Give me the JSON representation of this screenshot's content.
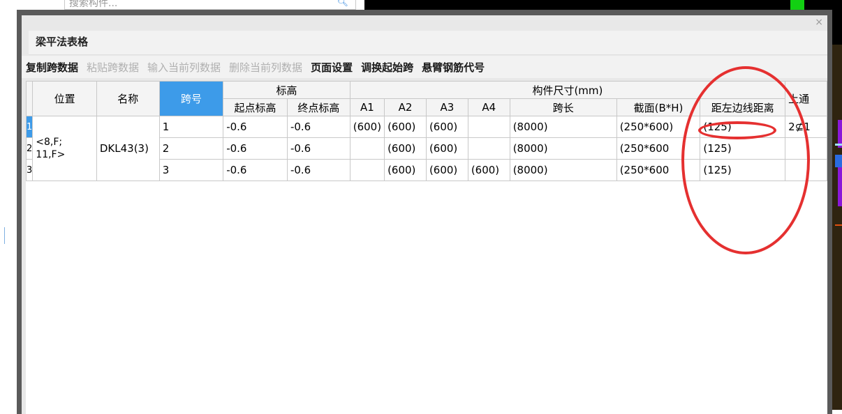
{
  "background": {
    "search_placeholder": "搜索构件..."
  },
  "dialog": {
    "title": "梁平法表格",
    "close_label": "×",
    "toolbar": [
      {
        "label": "复制跨数据",
        "enabled": true
      },
      {
        "label": "粘贴跨数据",
        "enabled": false
      },
      {
        "label": "输入当前列数据",
        "enabled": false
      },
      {
        "label": "删除当前列数据",
        "enabled": false
      },
      {
        "label": "页面设置",
        "enabled": true
      },
      {
        "label": "调换起始跨",
        "enabled": true
      },
      {
        "label": "悬臂钢筋代号",
        "enabled": true
      }
    ]
  },
  "table": {
    "headers": {
      "position": "位置",
      "name": "名称",
      "span_no": "跨号",
      "elevation_group": "标高",
      "start_elev": "起点标高",
      "end_elev": "终点标高",
      "size_group": "构件尺寸(mm)",
      "a1": "A1",
      "a2": "A2",
      "a3": "A3",
      "a4": "A4",
      "span_length": "跨长",
      "section": "截面(B*H)",
      "left_edge_dist": "距左边线距离",
      "upper": "上通"
    },
    "position": "<8,F;\n11,F>",
    "name": "DKL43(3)",
    "rows": [
      {
        "rownum": "1",
        "span": "1",
        "start": "-0.6",
        "end": "-0.6",
        "a1": "(600)",
        "a2": "(600)",
        "a3": "(600)",
        "a4": "",
        "length": "(8000)",
        "section": "(250*600)",
        "dist": "(125)",
        "upper": "2⊈1"
      },
      {
        "rownum": "2",
        "span": "2",
        "start": "-0.6",
        "end": "-0.6",
        "a1": "",
        "a2": "(600)",
        "a3": "(600)",
        "a4": "",
        "length": "(8000)",
        "section": "(250*600",
        "dist": "(125)",
        "upper": ""
      },
      {
        "rownum": "3",
        "span": "3",
        "start": "-0.6",
        "end": "-0.6",
        "a1": "",
        "a2": "(600)",
        "a3": "(600)",
        "a4": "(600)",
        "length": "(8000)",
        "section": "(250*600",
        "dist": "(125)",
        "upper": ""
      }
    ]
  },
  "colors": {
    "header_highlight": "#3d9be9",
    "annotation_red": "#e53030"
  }
}
